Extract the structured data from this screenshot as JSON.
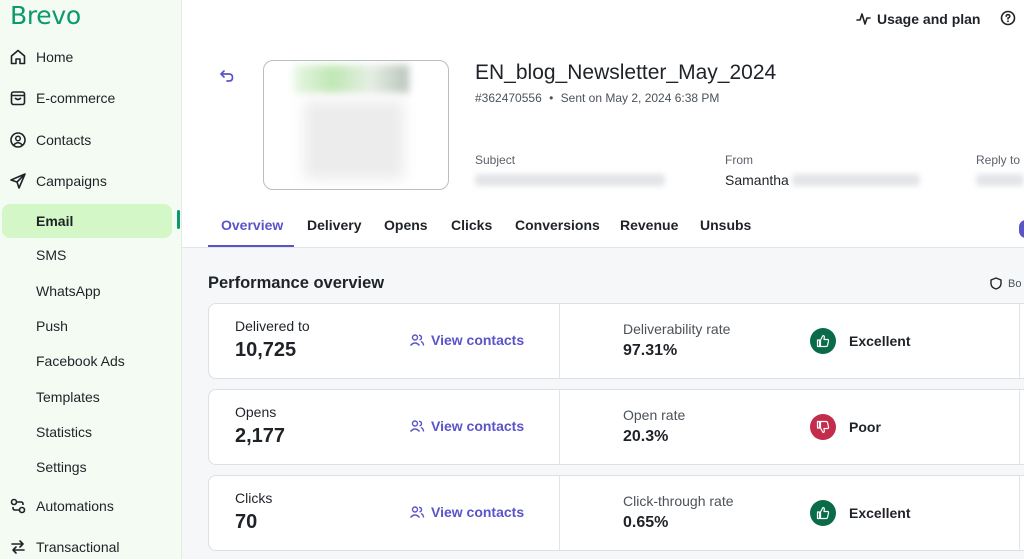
{
  "brand": {
    "logo": "Brevo",
    "accent": "#0b996e",
    "link_color": "#5a54c9"
  },
  "topbar": {
    "usage_label": "Usage and plan"
  },
  "sidebar": {
    "items": [
      {
        "label": "Home",
        "icon": "home-icon"
      },
      {
        "label": "E-commerce",
        "icon": "bag-icon"
      },
      {
        "label": "Contacts",
        "icon": "user-circle-icon"
      },
      {
        "label": "Campaigns",
        "icon": "send-icon"
      },
      {
        "label": "Email",
        "active": true
      },
      {
        "label": "SMS"
      },
      {
        "label": "WhatsApp"
      },
      {
        "label": "Push"
      },
      {
        "label": "Facebook Ads"
      },
      {
        "label": "Templates"
      },
      {
        "label": "Statistics"
      },
      {
        "label": "Settings"
      },
      {
        "label": "Automations",
        "icon": "automation-icon"
      },
      {
        "label": "Transactional",
        "icon": "transfer-icon"
      }
    ]
  },
  "campaign": {
    "name": "EN_blog_Newsletter_May_2024",
    "id": "#362470556",
    "separator": "•",
    "sent": "Sent on May 2, 2024 6:38 PM",
    "subject_label": "Subject",
    "from_label": "From",
    "from_value": "Samantha",
    "reply_label": "Reply to"
  },
  "tabs": [
    "Overview",
    "Delivery",
    "Opens",
    "Clicks",
    "Conversions",
    "Revenue",
    "Unsubs"
  ],
  "overview": {
    "title": "Performance overview",
    "bot_filter": "Bo",
    "cards": [
      {
        "label": "Delivered to",
        "value": "10,725",
        "link": "View contacts",
        "rate_label": "Deliverability rate",
        "rate_value": "97.31%",
        "rating": "Excellent",
        "good": true
      },
      {
        "label": "Opens",
        "value": "2,177",
        "link": "View contacts",
        "rate_label": "Open rate",
        "rate_value": "20.3%",
        "rating": "Poor",
        "good": false
      },
      {
        "label": "Clicks",
        "value": "70",
        "link": "View contacts",
        "rate_label": "Click-through rate",
        "rate_value": "0.65%",
        "rating": "Excellent",
        "good": true
      }
    ]
  }
}
